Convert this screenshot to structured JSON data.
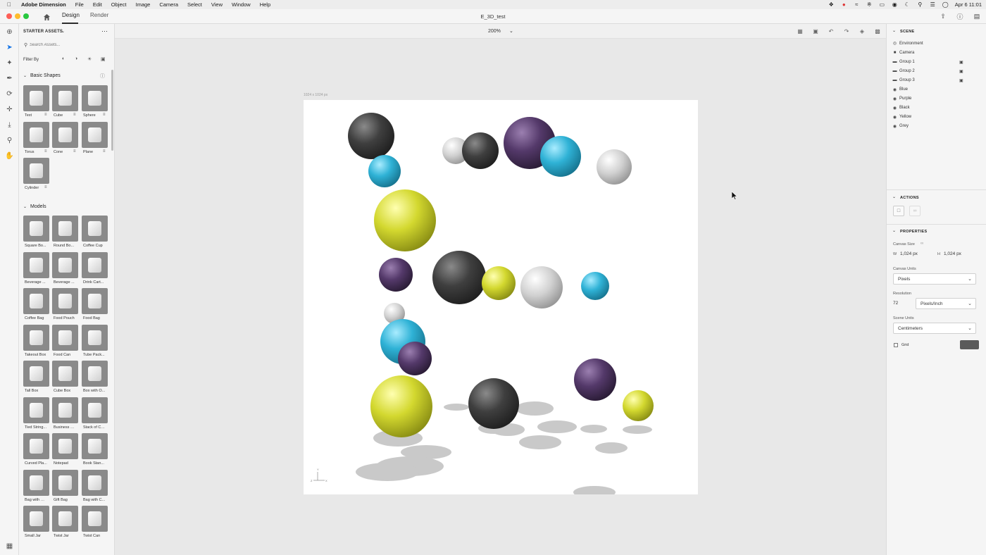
{
  "menubar": {
    "app_name": "Adobe Dimension",
    "items": [
      "File",
      "Edit",
      "Object",
      "Image",
      "Camera",
      "Select",
      "View",
      "Window",
      "Help"
    ],
    "date_time": "Apr 6  11:01"
  },
  "titlebar": {
    "tabs": [
      {
        "label": "Design",
        "active": true
      },
      {
        "label": "Render",
        "active": false
      }
    ],
    "document_title": "E_3D_test"
  },
  "assets": {
    "header": "STARTER ASSETS",
    "search_placeholder": "Search Assets...",
    "filter_label": "Filter By",
    "basic_shapes": {
      "title": "Basic Shapes",
      "items": [
        "Text",
        "Cube",
        "Sphere",
        "Torus",
        "Cone",
        "Plane",
        "Cylinder"
      ]
    },
    "models": {
      "title": "Models",
      "items": [
        "Square Bo...",
        "Round Bo...",
        "Coffee Cup",
        "Beverage ...",
        "Beverage ...",
        "Drink Cart...",
        "Coffee Bag",
        "Food Pouch",
        "Food Bag",
        "Takeout Box",
        "Food Can",
        "Tube Pack...",
        "Tall Box",
        "Cube Box",
        "Box with O...",
        "Tied String...",
        "Business C...",
        "Stack of Ca...",
        "Curved Pla...",
        "Notepad",
        "Book Stan...",
        "Bag with W...",
        "Gift Bag",
        "Bag with C...",
        "Small Jar",
        "Twist Jar",
        "Twist Can"
      ]
    }
  },
  "canvas": {
    "zoom": "200%",
    "size_label": "1024 x 1024 px",
    "axis_labels": {
      "y": "Y",
      "z": "Z",
      "x": "X"
    },
    "spheres": [
      {
        "material": "black"
      },
      {
        "material": "blue"
      },
      {
        "material": "grey"
      },
      {
        "material": "black"
      },
      {
        "material": "purple"
      },
      {
        "material": "blue"
      },
      {
        "material": "grey"
      },
      {
        "material": "yellow"
      },
      {
        "material": "purple"
      },
      {
        "material": "black"
      },
      {
        "material": "yellow"
      },
      {
        "material": "grey"
      },
      {
        "material": "blue"
      },
      {
        "material": "grey"
      },
      {
        "material": "blue"
      },
      {
        "material": "purple"
      },
      {
        "material": "yellow"
      },
      {
        "material": "black"
      },
      {
        "material": "purple"
      },
      {
        "material": "yellow"
      }
    ]
  },
  "scene": {
    "header": "SCENE",
    "items": [
      {
        "label": "Environment",
        "icon": "environment-icon",
        "locked": false
      },
      {
        "label": "Camera",
        "icon": "camera-icon",
        "locked": false
      },
      {
        "label": "Group 1",
        "icon": "folder-icon",
        "locked": true
      },
      {
        "label": "Group 2",
        "icon": "folder-icon",
        "locked": true
      },
      {
        "label": "Group 3",
        "icon": "folder-icon",
        "locked": true
      },
      {
        "label": "Blue",
        "icon": "light-icon",
        "locked": false
      },
      {
        "label": "Purple",
        "icon": "light-icon",
        "locked": false
      },
      {
        "label": "Black",
        "icon": "light-icon",
        "locked": false
      },
      {
        "label": "Yellow",
        "icon": "light-icon",
        "locked": false
      },
      {
        "label": "Grey",
        "icon": "light-icon",
        "locked": false
      }
    ]
  },
  "actions": {
    "header": "ACTIONS"
  },
  "properties": {
    "header": "PROPERTIES",
    "canvas_size_label": "Canvas Size",
    "w_label": "W",
    "w_value": "1,024 px",
    "h_label": "H",
    "h_value": "1,024 px",
    "canvas_units_label": "Canvas Units",
    "canvas_units_value": "Pixels",
    "resolution_label": "Resolution",
    "resolution_value": "72",
    "resolution_units": "Pixels/Inch",
    "scene_units_label": "Scene Units",
    "scene_units_value": "Centimeters",
    "grid_label": "Grid",
    "grid_checked": false
  },
  "colors": {
    "accent": "#1473e6",
    "black": "#3a3a3a",
    "blue": "#27a7c9",
    "grey": "#c9c9c9",
    "purple": "#4e3a5c",
    "yellow": "#cfd42e",
    "grid_swatch": "#5a5a5a"
  }
}
